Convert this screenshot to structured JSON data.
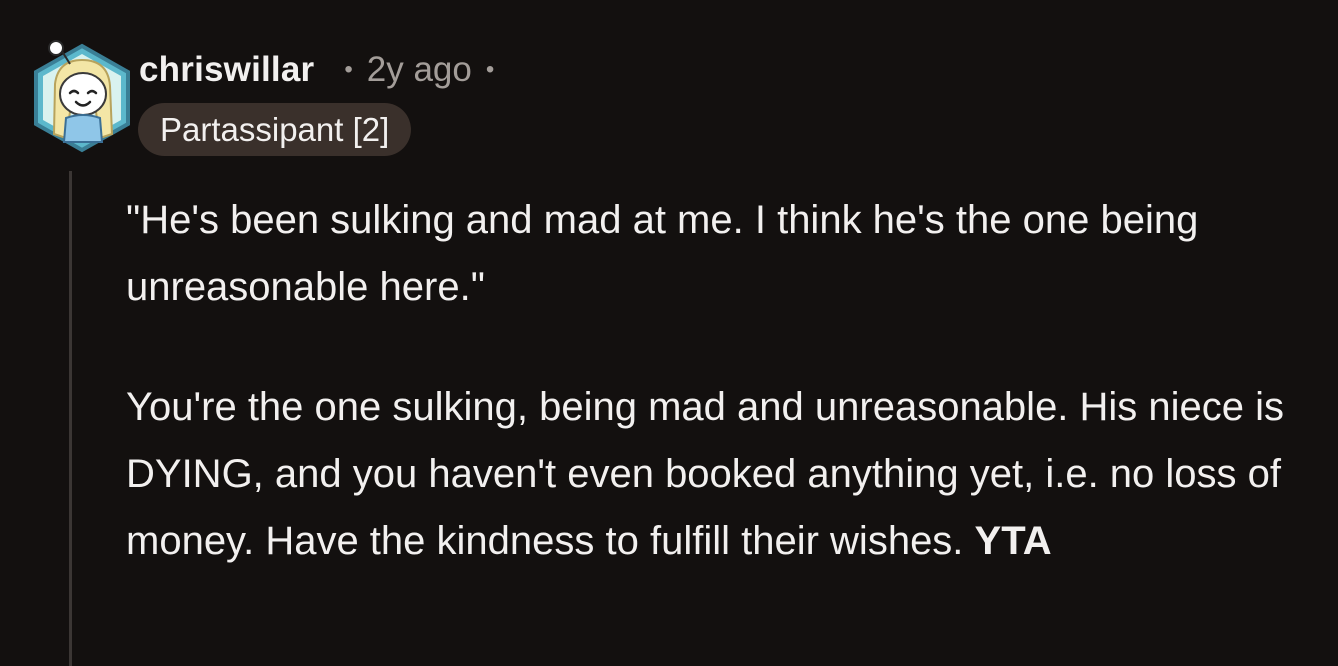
{
  "comment": {
    "author": "chriswillar",
    "separator": "•",
    "timestamp": "2y ago",
    "trailing_separator": "•",
    "flair": "Partassipant [2]",
    "avatar_icon": "snoo-avatar-icon",
    "paragraphs": [
      {
        "text": "\"He's been sulking and mad at me. I think he's the one being unreasonable here.\""
      },
      {
        "text": "You're the one sulking, being mad and unreasonable. His niece is DYING, and you haven't even booked anything yet, i.e. no loss of money. Have the kindness to fulfill their wishes. ",
        "bold_suffix": "YTA"
      }
    ]
  },
  "colors": {
    "background": "#13100f",
    "text_primary": "#f2f0ef",
    "text_muted": "#a39d99",
    "flair_bg": "#3a302b",
    "thread_line": "#3b3634",
    "avatar_frame": "#58a9c4"
  }
}
